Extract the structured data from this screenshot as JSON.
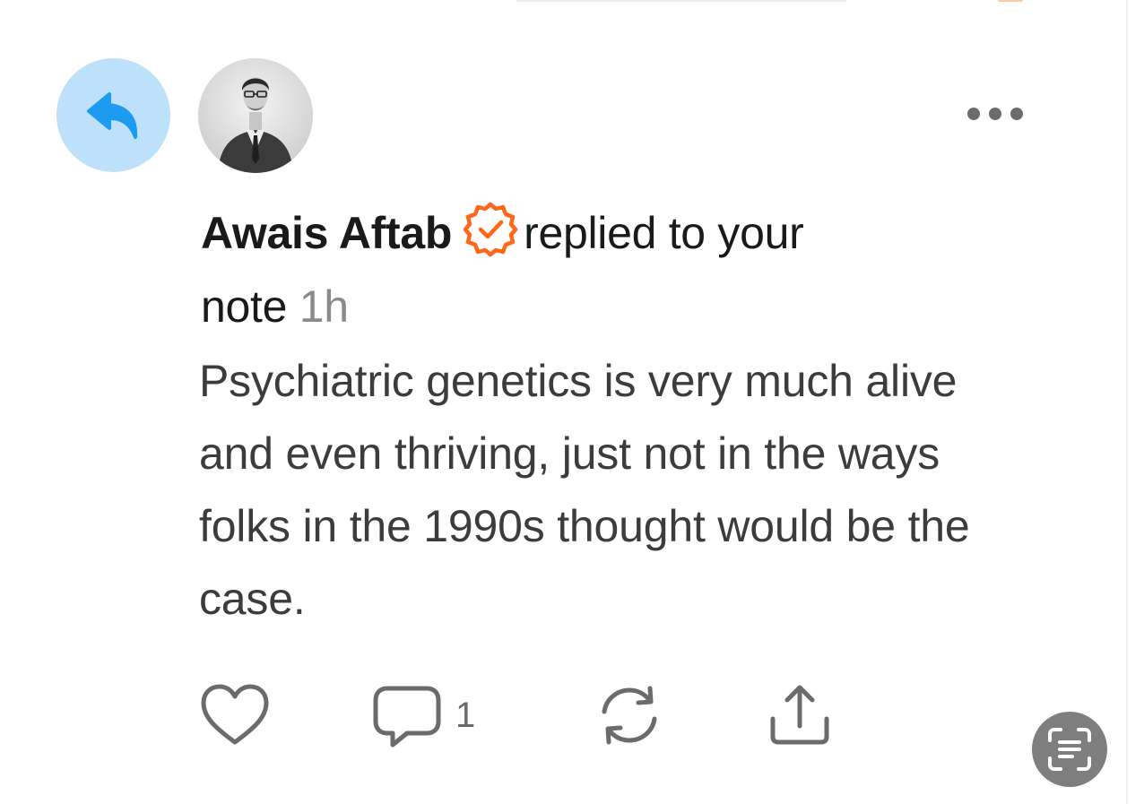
{
  "notification": {
    "author": "Awais Aftab",
    "action_line1": "replied to your",
    "action_line2": "note",
    "time": "1h",
    "body": "Psychiatric genetics is very much alive and even thriving, just not in the ways folks in the 1990s thought would be the case.",
    "comment_count": "1"
  },
  "icons": {
    "type_badge": "reply-arrow-icon",
    "verified": "verified-check-icon",
    "more": "more-dots-icon",
    "like": "heart-icon",
    "comment": "comment-bubble-icon",
    "restack": "restack-icon",
    "share": "share-icon",
    "scan": "live-text-scan-icon"
  },
  "colors": {
    "reply_badge_bg": "#bde0fb",
    "reply_arrow": "#1d9bf0",
    "verified_badge": "#ff6719",
    "timestamp": "#8a8a8a",
    "action_icons": "#6b6b6b"
  }
}
